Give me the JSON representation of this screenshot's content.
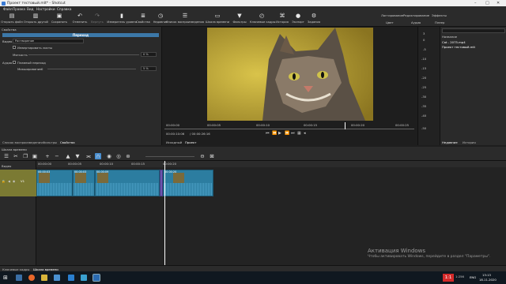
{
  "window": {
    "title": "Проект тестовый.mlt* - Shotcut"
  },
  "menu": [
    "Файл",
    "Правка",
    "Вид",
    "Настройки",
    "Справка"
  ],
  "toolbar": {
    "items": [
      {
        "label": "Открыть файл",
        "icon": "folder-icon"
      },
      {
        "label": "Открыть другой",
        "icon": "open-other-icon"
      },
      {
        "label": "Сохранить",
        "icon": "save-icon"
      },
      {
        "label": "Отменить",
        "icon": "undo-icon"
      },
      {
        "label": "Вернуть",
        "icon": "redo-icon"
      },
      {
        "label": "Измеритель уровня",
        "icon": "meter-icon"
      },
      {
        "label": "Свойства",
        "icon": "properties-icon"
      },
      {
        "label": "Недавние",
        "icon": "recent-icon"
      },
      {
        "label": "Список воспроизведения",
        "icon": "playlist-icon"
      },
      {
        "label": "Шкала времени",
        "icon": "timeline-icon"
      },
      {
        "label": "Фильтры",
        "icon": "filter-icon"
      },
      {
        "label": "Ключевые кадры",
        "icon": "keyframes-icon"
      },
      {
        "label": "История",
        "icon": "history-icon"
      },
      {
        "label": "Экспорт",
        "icon": "export-icon"
      },
      {
        "label": "Задания",
        "icon": "jobs-icon"
      }
    ],
    "layouts_top": [
      "Логгирование",
      "Редактирование",
      "Эффекты"
    ],
    "layouts_bottom": [
      "Цвет",
      "Аудио",
      "Плеер"
    ]
  },
  "properties": {
    "title": "Свойства",
    "header": "Переход",
    "video_label": "Видео",
    "video_value": "Растворение",
    "invert_label": "Инвертировать листы",
    "softness_label": "Мягкость",
    "softness_value": "0 %",
    "audio_label": "Аудио",
    "crossfade_label": "Плавный переход",
    "mix_label": "Микширование",
    "mix_value": "0",
    "mix_pct": "5 %"
  },
  "left_tabs": [
    "Список воспроизведения",
    "Фильтры",
    "Свойства"
  ],
  "viewer": {
    "ruler_ticks": [
      "00:00:00",
      "00:00:05",
      "00:00:10",
      "00:00:15",
      "00:00:20",
      "00:00:25"
    ],
    "position": "00:00:10:06",
    "duration": "/ 00:00:26:16",
    "source_tab": "Исходный",
    "project_tab": "Проект"
  },
  "meter": {
    "scale": [
      "3",
      "0",
      "-5",
      "-10",
      "-15",
      "-20",
      "-25",
      "-30",
      "-35",
      "-40",
      "-50"
    ]
  },
  "recent": {
    "header": "Название",
    "items": [
      "Cat - 2075.mp4",
      "Проект тестовый.mlt"
    ],
    "tabs": [
      "Недавние",
      "История"
    ]
  },
  "timeline": {
    "panel_label": "Шкала времени",
    "track_name": "Видео",
    "track_id": "V1",
    "ruler": [
      "00:00:00",
      "00:00:05",
      "00:00:10",
      "00:00:15",
      "00:00:20"
    ],
    "clip_timecodes": [
      "00:00:03",
      "00:00:03",
      "00:00:09",
      "00:00:15",
      "00:00:20"
    ]
  },
  "bottom_tabs": [
    "Ключевые кадры",
    "Шкала времени"
  ],
  "watermark": {
    "line1": "Активация Windows",
    "line2": "Чтобы активировать Windows, перейдите в раздел \"Параметры\"."
  },
  "taskbar": {
    "time": "13:13",
    "date": "18.11.2020",
    "lang": "ENG",
    "badge": "1:1",
    "badge_label": "1:256",
    "accent": "#d42a2a"
  }
}
